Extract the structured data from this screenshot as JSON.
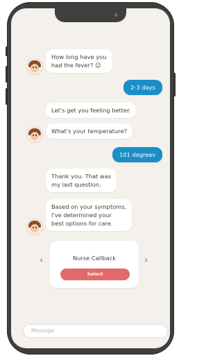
{
  "chat": {
    "messages": [
      {
        "from": "bot",
        "text": "How long have you had the fever?"
      },
      {
        "from": "user",
        "text": "2-3 days"
      },
      {
        "from": "bot",
        "text": "Let's get you feeling better."
      },
      {
        "from": "bot",
        "text": "What's your temperature?"
      },
      {
        "from": "user",
        "text": "101 degrees"
      },
      {
        "from": "bot",
        "text": "Thank you. That was my last question."
      },
      {
        "from": "bot",
        "text": "Based on your symptoms, I've determined your best options for care."
      }
    ],
    "lines": {
      "m1a": "How long have you",
      "m1b": "had the fever? ☺",
      "m2": "2-3 days",
      "m3": "Let's get you feeling better.",
      "m4": "What's your temperature?",
      "m5": "101 degrees",
      "m6a": "Thank you. That was",
      "m6b": "my last question.",
      "m7a": "Based on your symptoms,",
      "m7b": "I've determined your",
      "m7c": "best options for care."
    }
  },
  "care_option": {
    "title": "Nurse Callback",
    "button_label": "Select"
  },
  "carousel": {
    "prev_icon": "‹",
    "next_icon": "›"
  },
  "composer": {
    "placeholder": "Message"
  },
  "colors": {
    "user_bubble": "#1a8ec8",
    "select_button": "#e46a6a",
    "screen_background": "#f4f0eb"
  }
}
